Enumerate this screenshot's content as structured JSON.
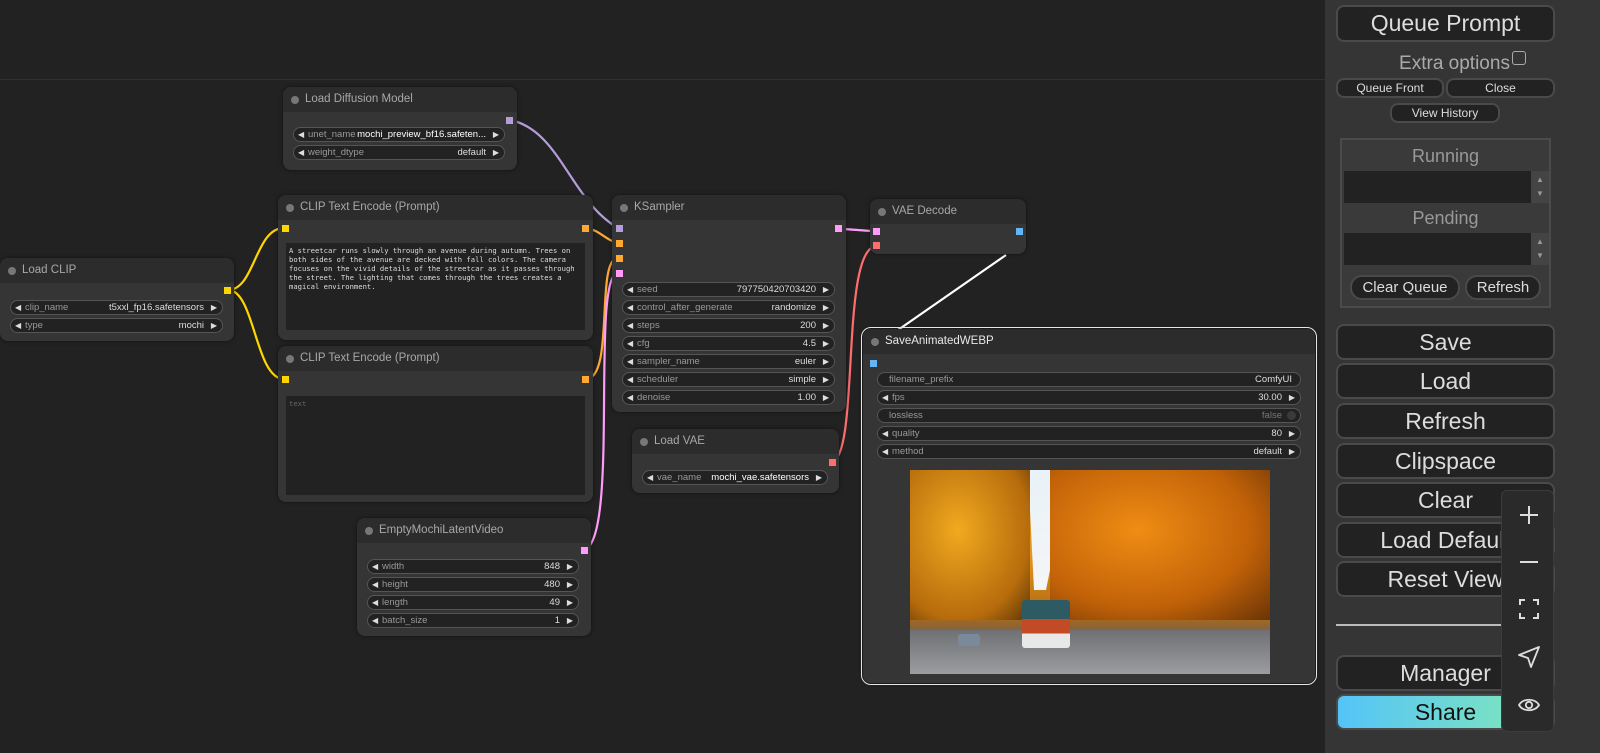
{
  "canvas": {
    "nodes": {
      "load_diffusion_model": {
        "title": "Load Diffusion Model",
        "widgets": [
          {
            "label": "unet_name",
            "value": "mochi_preview_bf16.safeten..."
          },
          {
            "label": "weight_dtype",
            "value": "default"
          }
        ]
      },
      "load_clip": {
        "title": "Load CLIP",
        "widgets": [
          {
            "label": "clip_name",
            "value": "t5xxl_fp16.safetensors"
          },
          {
            "label": "type",
            "value": "mochi"
          }
        ]
      },
      "clip_text_encode_positive": {
        "title": "CLIP Text Encode (Prompt)",
        "text": "A streetcar runs slowly through an avenue during autumn. Trees on both sides of the avenue are decked with fall colors. The camera focuses on the vivid details of the streetcar as it passes through the street. The lighting that comes through the trees creates a magical environment."
      },
      "clip_text_encode_negative": {
        "title": "CLIP Text Encode (Prompt)",
        "text": "",
        "placeholder": "text"
      },
      "ksampler": {
        "title": "KSampler",
        "widgets": [
          {
            "label": "seed",
            "value": "797750420703420"
          },
          {
            "label": "control_after_generate",
            "value": "randomize"
          },
          {
            "label": "steps",
            "value": "200"
          },
          {
            "label": "cfg",
            "value": "4.5"
          },
          {
            "label": "sampler_name",
            "value": "euler"
          },
          {
            "label": "scheduler",
            "value": "simple"
          },
          {
            "label": "denoise",
            "value": "1.00"
          }
        ]
      },
      "vae_decode": {
        "title": "VAE Decode"
      },
      "load_vae": {
        "title": "Load VAE",
        "widgets": [
          {
            "label": "vae_name",
            "value": "mochi_vae.safetensors"
          }
        ]
      },
      "empty_mochi_latent_video": {
        "title": "EmptyMochiLatentVideo",
        "widgets": [
          {
            "label": "width",
            "value": "848"
          },
          {
            "label": "height",
            "value": "480"
          },
          {
            "label": "length",
            "value": "49"
          },
          {
            "label": "batch_size",
            "value": "1"
          }
        ]
      },
      "save_animated_webp": {
        "title": "SaveAnimatedWEBP",
        "widgets": [
          {
            "label": "filename_prefix",
            "value": "ComfyUI"
          },
          {
            "label": "fps",
            "value": "30.00"
          },
          {
            "label": "lossless",
            "value": "false"
          },
          {
            "label": "quality",
            "value": "80"
          },
          {
            "label": "method",
            "value": "default"
          }
        ],
        "preview_alt": "Streetcar on autumn avenue lined with orange trees"
      }
    },
    "link_colors": {
      "model": "#b39ddb",
      "clip": "#ffd500",
      "conditioning": "#ffa931",
      "latent": "#ff9cf9",
      "vae": "#ff6e6e",
      "image": "#64b5f6"
    }
  },
  "sidebar": {
    "queue_prompt": "Queue Prompt",
    "extra_options": "Extra options",
    "queue_front": "Queue Front",
    "close": "Close",
    "view_history": "View History",
    "running": "Running",
    "pending": "Pending",
    "clear_queue": "Clear Queue",
    "refresh_queue": "Refresh",
    "save": "Save",
    "load": "Load",
    "refresh": "Refresh",
    "clipspace": "Clipspace",
    "clear": "Clear",
    "load_default": "Load Default",
    "reset_view": "Reset View",
    "manager": "Manager",
    "share": "Share"
  },
  "zoom_controls": [
    "zoom-in-icon",
    "zoom-out-icon",
    "fit-view-icon",
    "locate-icon",
    "toggle-links-icon"
  ]
}
